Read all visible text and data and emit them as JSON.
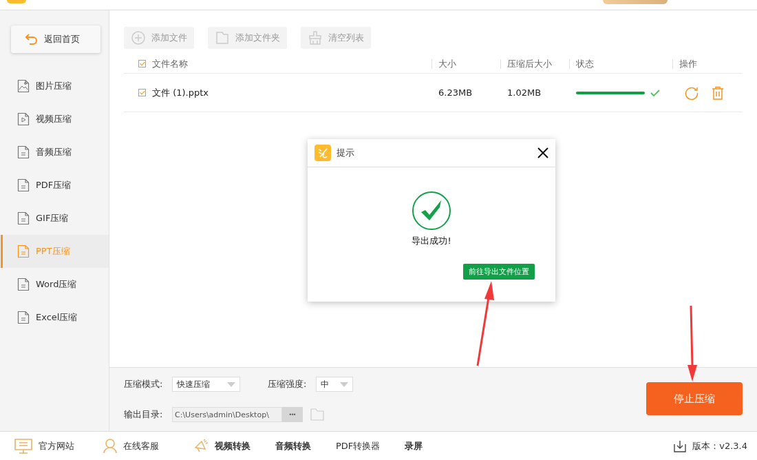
{
  "sidebar": {
    "home_button": "返回首页",
    "items": [
      {
        "label": "图片压缩",
        "selected": false
      },
      {
        "label": "视频压缩",
        "selected": false
      },
      {
        "label": "音频压缩",
        "selected": false
      },
      {
        "label": "PDF压缩",
        "selected": false
      },
      {
        "label": "GIF压缩",
        "selected": false
      },
      {
        "label": "PPT压缩",
        "selected": true
      },
      {
        "label": "Word压缩",
        "selected": false
      },
      {
        "label": "Excel压缩",
        "selected": false
      }
    ]
  },
  "toolbar": [
    {
      "label": "添加文件",
      "disabled": true
    },
    {
      "label": "添加文件夹",
      "disabled": true
    },
    {
      "label": "清空列表",
      "disabled": true
    }
  ],
  "table": {
    "all_checked": true,
    "columns": [
      "文件名称",
      "大小",
      "压缩后大小",
      "状态",
      "操作"
    ],
    "rows": [
      {
        "checked": true,
        "name": "文件 (1).pptx",
        "size": "6.23MB",
        "compressed_size": "1.02MB",
        "level": 1.0,
        "done": true
      }
    ]
  },
  "dialog": {
    "title": "提示",
    "message": "导出成功!",
    "button": "前往导出文件位置"
  },
  "settings": {
    "mode_label": "压缩模式:",
    "mode_value": "快速压缩",
    "strength_label": "压缩强度:",
    "strength_value": "中",
    "output_label": "输出目录:",
    "output_path": "C:\\Users\\admin\\Desktop\\",
    "more_button": "•••",
    "start_button": "停止压缩"
  },
  "footer": {
    "links": [
      {
        "label": "官方网站",
        "bold": false
      },
      {
        "label": "在线客服",
        "bold": false
      },
      {
        "label": "视频转换",
        "bold": true
      },
      {
        "label": "音频转换",
        "bold": true
      },
      {
        "label": "PDF转换器",
        "bold": false
      },
      {
        "label": "录屏",
        "bold": true
      }
    ],
    "version": "版本：v2.3.4"
  }
}
